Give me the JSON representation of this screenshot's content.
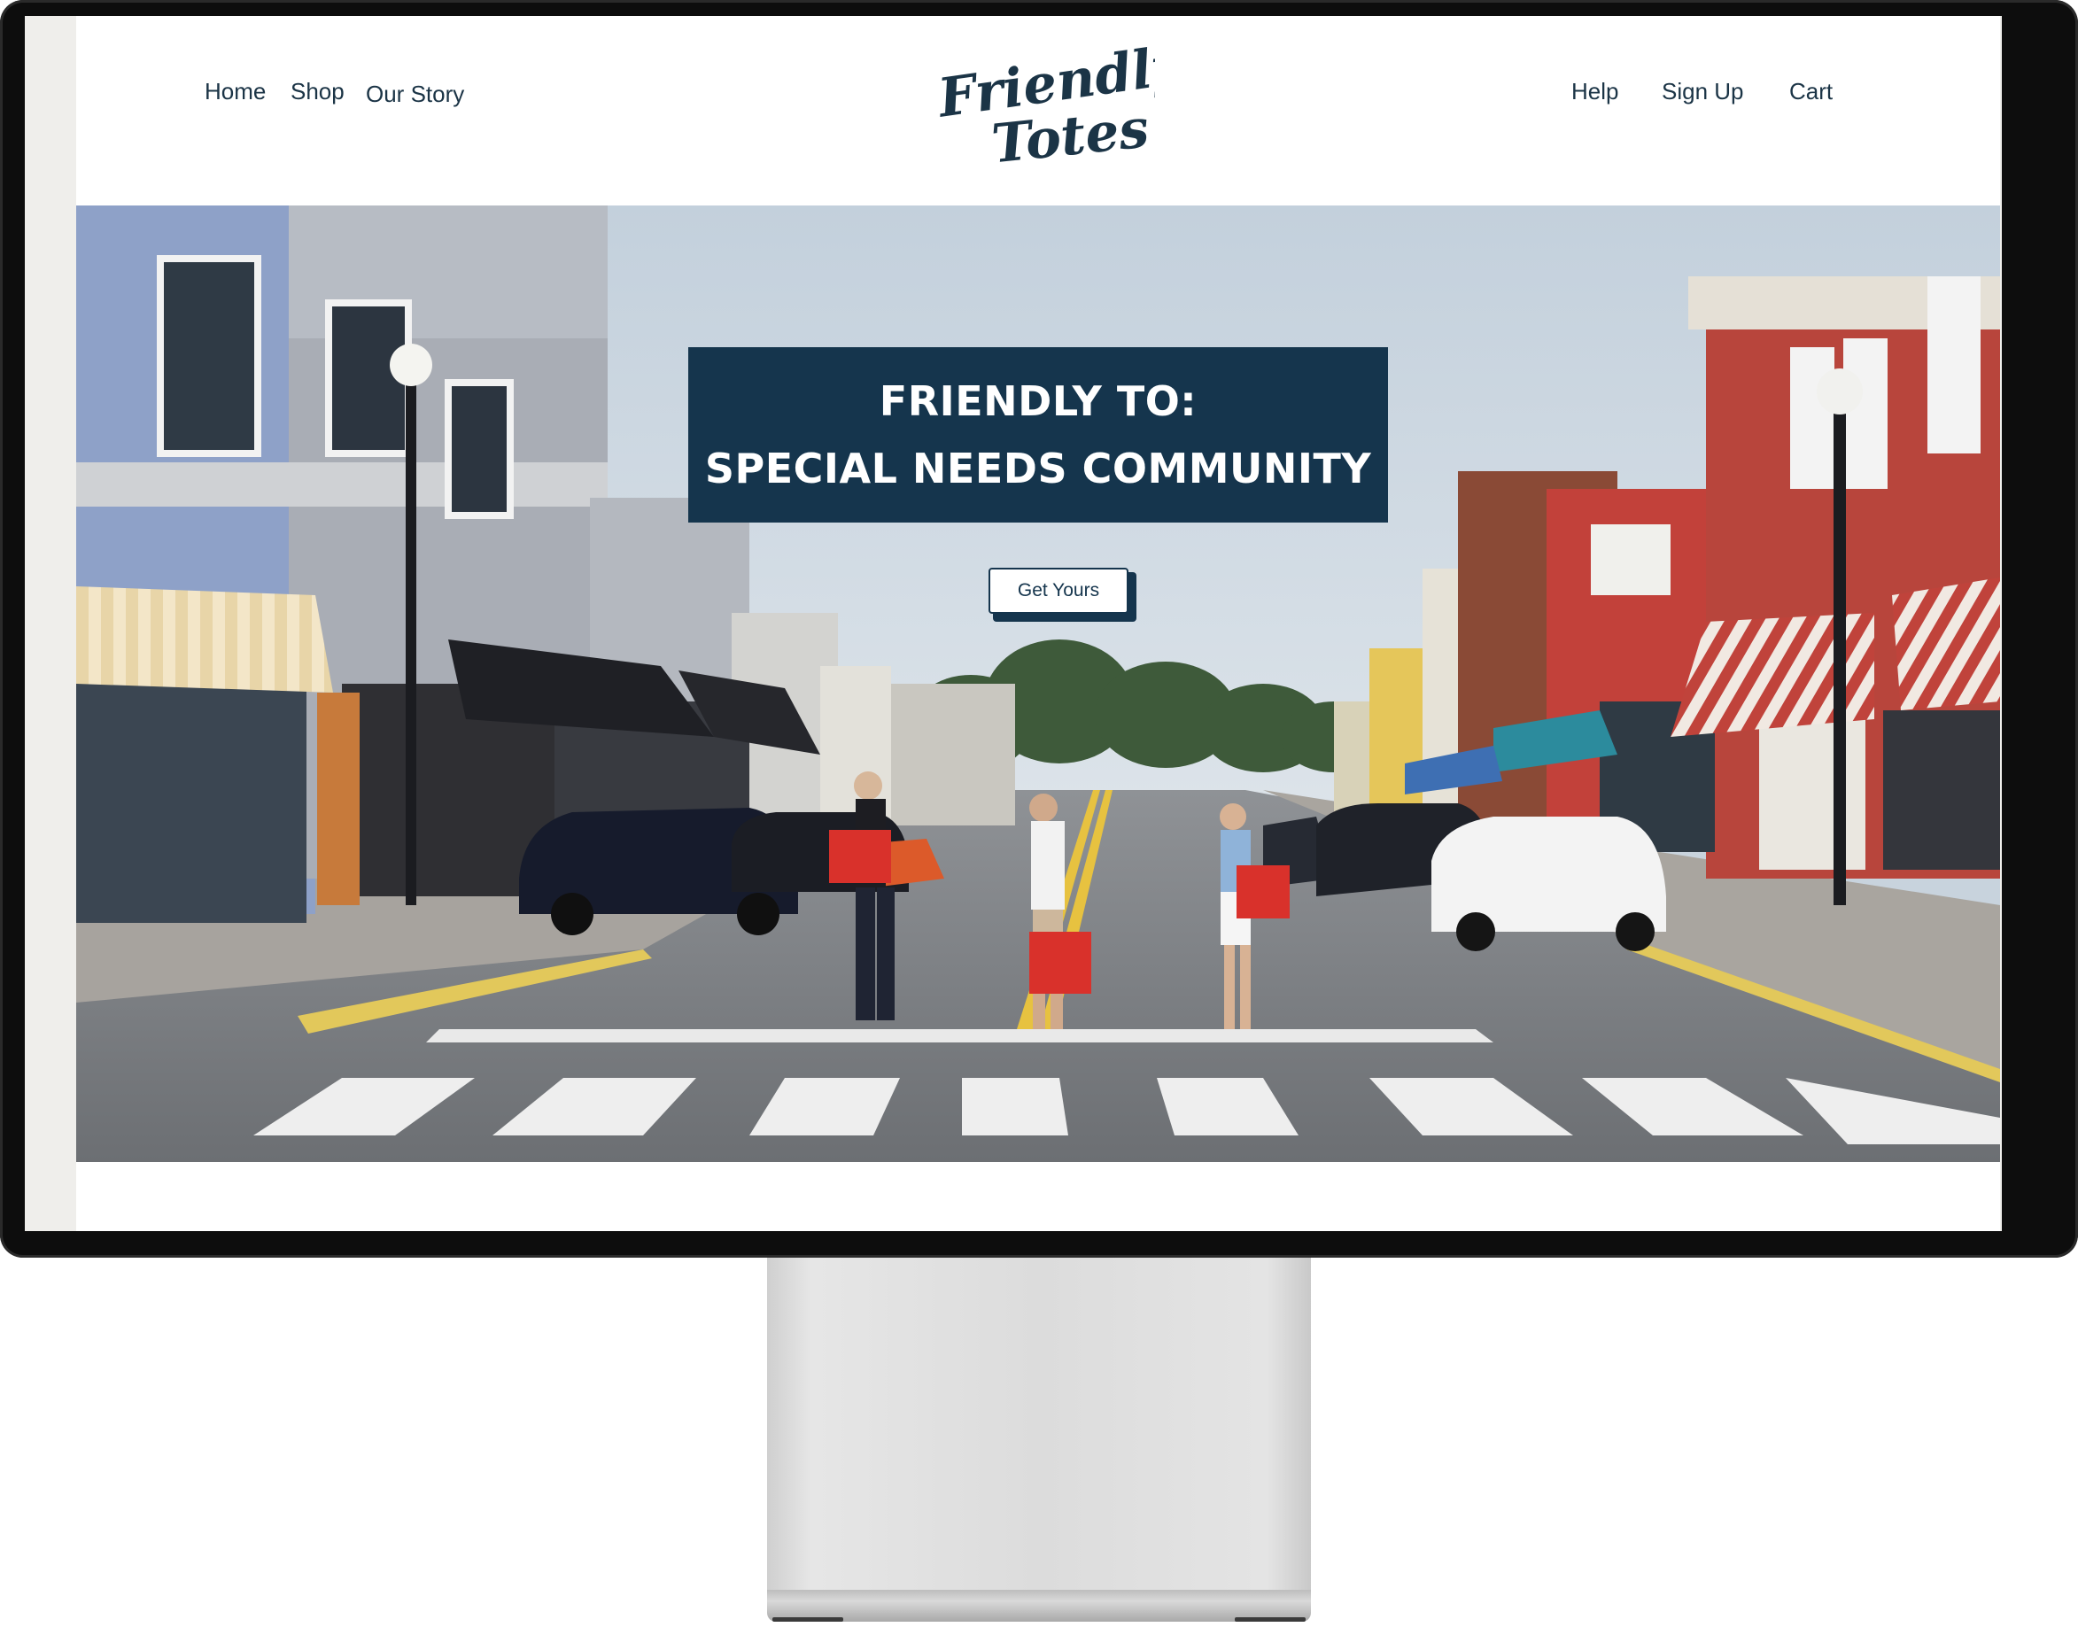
{
  "nav": {
    "left": [
      {
        "label": "Home"
      },
      {
        "label": "Shop"
      },
      {
        "label": "Our Story"
      }
    ],
    "right": [
      {
        "label": "Help"
      },
      {
        "label": "Sign Up"
      },
      {
        "label": "Cart"
      }
    ]
  },
  "logo": {
    "line1": "Friendly",
    "line2": "Totes"
  },
  "hero": {
    "headline_line1": "FRIENDLY TO:",
    "headline_line2": "SPECIAL NEEDS COMMUNITY",
    "cta_label": "Get Yours"
  },
  "colors": {
    "brand_navy": "#15354d",
    "nav_text": "#1b3446",
    "tote_red": "#d9312b"
  }
}
